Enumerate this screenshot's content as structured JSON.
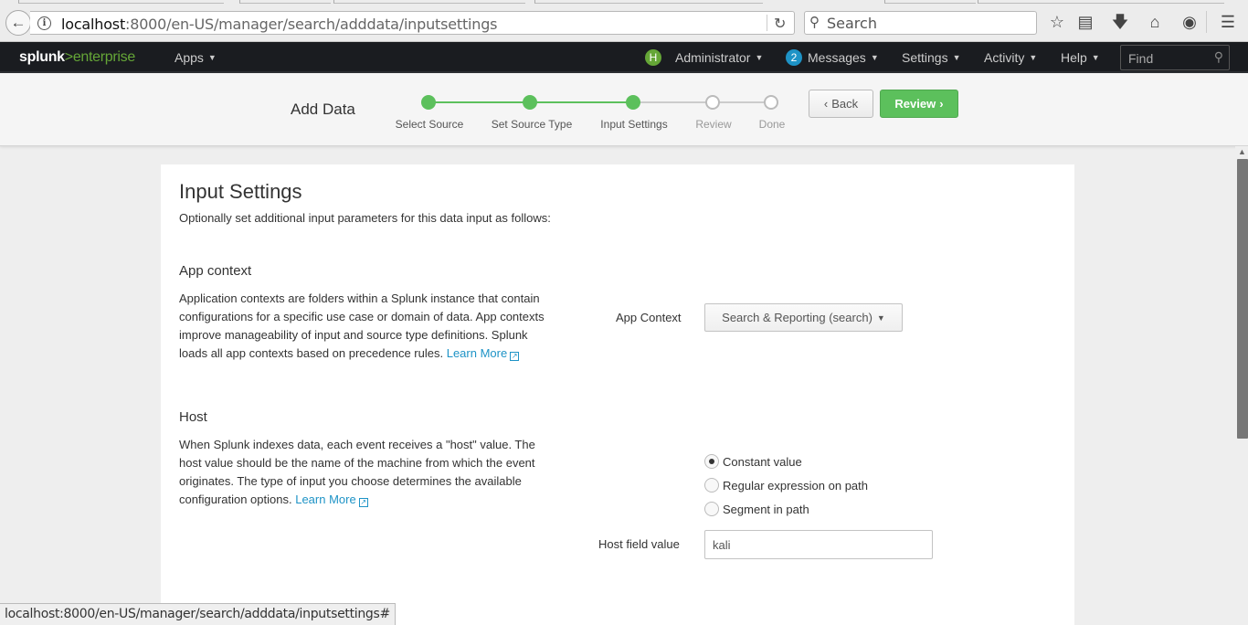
{
  "browser": {
    "url_host": "localhost",
    "url_path": ":8000/en-US/manager/search/adddata/inputsettings",
    "search_placeholder": "Search",
    "status_url": "localhost:8000/en-US/manager/search/adddata/inputsettings#"
  },
  "nav": {
    "logo_main": "splunk",
    "logo_gt": ">",
    "logo_product": "enterprise",
    "apps": "Apps",
    "user_initial": "H",
    "user": "Administrator",
    "message_count": "2",
    "messages": "Messages",
    "settings": "Settings",
    "activity": "Activity",
    "help": "Help",
    "find_placeholder": "Find"
  },
  "wizard": {
    "title": "Add Data",
    "steps": [
      {
        "label": "Select Source",
        "state": "done"
      },
      {
        "label": "Set Source Type",
        "state": "done"
      },
      {
        "label": "Input Settings",
        "state": "done"
      },
      {
        "label": "Review",
        "state": "todo"
      },
      {
        "label": "Done",
        "state": "todo"
      }
    ],
    "back_label": "Back",
    "review_label": "Review"
  },
  "page": {
    "title": "Input Settings",
    "subtitle": "Optionally set additional input parameters for this data input as follows:"
  },
  "app_context": {
    "title": "App context",
    "description": "Application contexts are folders within a Splunk instance that contain configurations for a specific use case or domain of data. App contexts improve manageability of input and source type definitions. Splunk loads all app contexts based on precedence rules.",
    "learn_more": "Learn More",
    "field_label": "App Context",
    "selected": "Search & Reporting (search)"
  },
  "host": {
    "title": "Host",
    "description": "When Splunk indexes data, each event receives a \"host\" value. The host value should be the name of the machine from which the event originates. The type of input you choose determines the available configuration options.",
    "learn_more": "Learn More",
    "options": [
      {
        "label": "Constant value",
        "checked": true
      },
      {
        "label": "Regular expression on path",
        "checked": false
      },
      {
        "label": "Segment in path",
        "checked": false
      }
    ],
    "field_label": "Host field value",
    "field_value": "kali"
  },
  "colors": {
    "accent_green": "#5cc05c",
    "link_blue": "#1e93c6",
    "nav_bg": "#1a1c20"
  }
}
